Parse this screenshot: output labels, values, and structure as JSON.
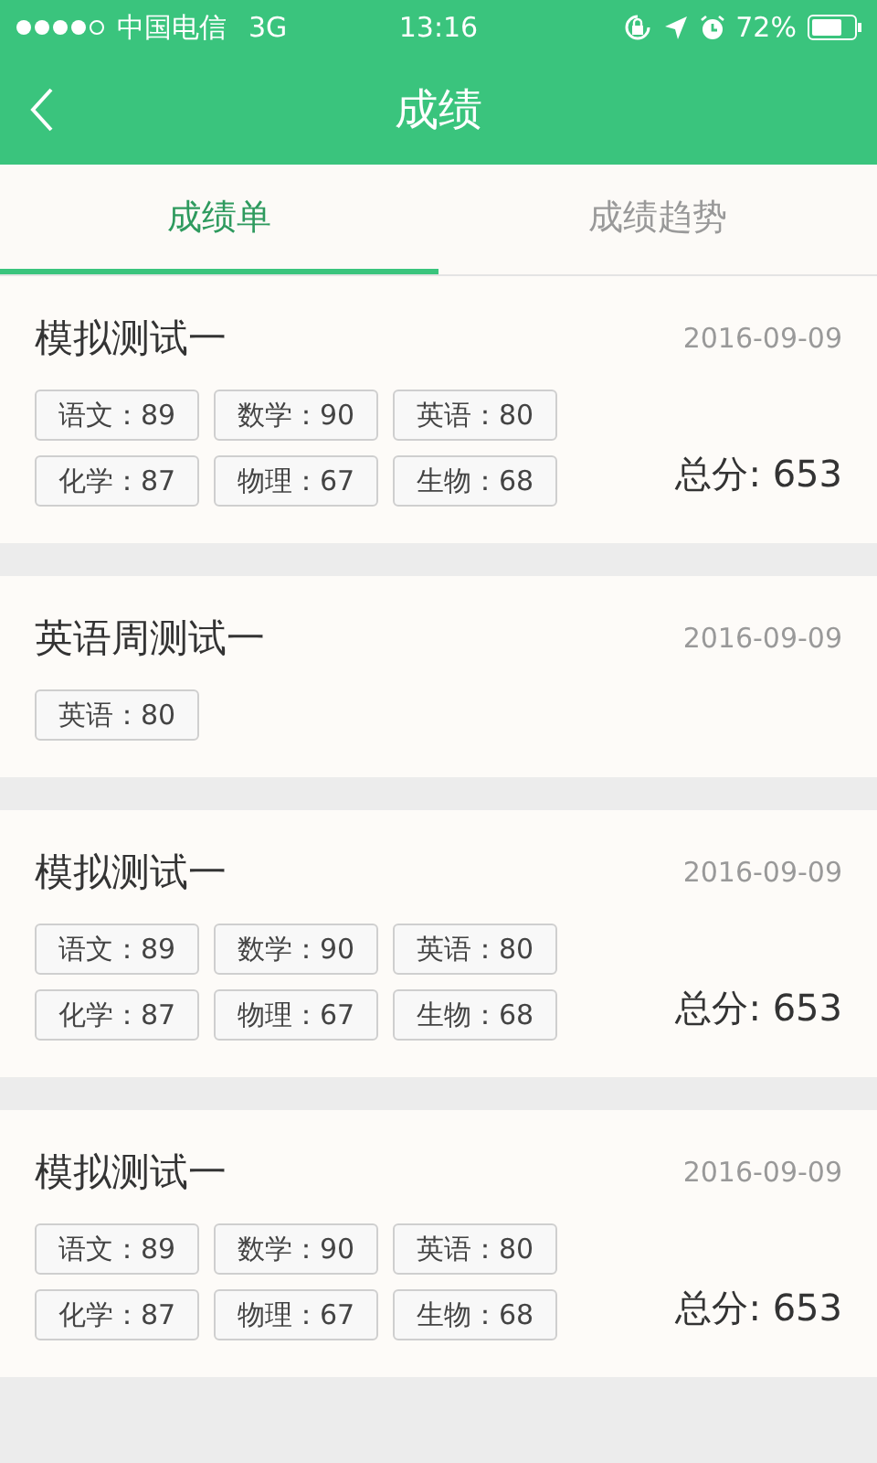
{
  "status_bar": {
    "carrier": "中国电信",
    "network": "3G",
    "time": "13:16",
    "battery": "72%"
  },
  "header": {
    "title": "成绩"
  },
  "tabs": [
    {
      "label": "成绩单",
      "selected": true
    },
    {
      "label": "成绩趋势",
      "selected": false
    }
  ],
  "exams": [
    {
      "title": "模拟测试一",
      "date": "2016-09-09",
      "scores": [
        "语文：89",
        "数学：90",
        "英语：80",
        "化学：87",
        "物理：67",
        "生物：68"
      ],
      "total": "总分: 653"
    },
    {
      "title": "英语周测试一",
      "date": "2016-09-09",
      "scores": [
        "英语：80"
      ]
    },
    {
      "title": "模拟测试一",
      "date": "2016-09-09",
      "scores": [
        "语文：89",
        "数学：90",
        "英语：80",
        "化学：87",
        "物理：67",
        "生物：68"
      ],
      "total": "总分: 653"
    },
    {
      "title": "模拟测试一",
      "date": "2016-09-09",
      "scores": [
        "语文：89",
        "数学：90",
        "英语：80",
        "化学：87",
        "物理：67",
        "生物：68"
      ],
      "total": "总分: 653"
    }
  ]
}
